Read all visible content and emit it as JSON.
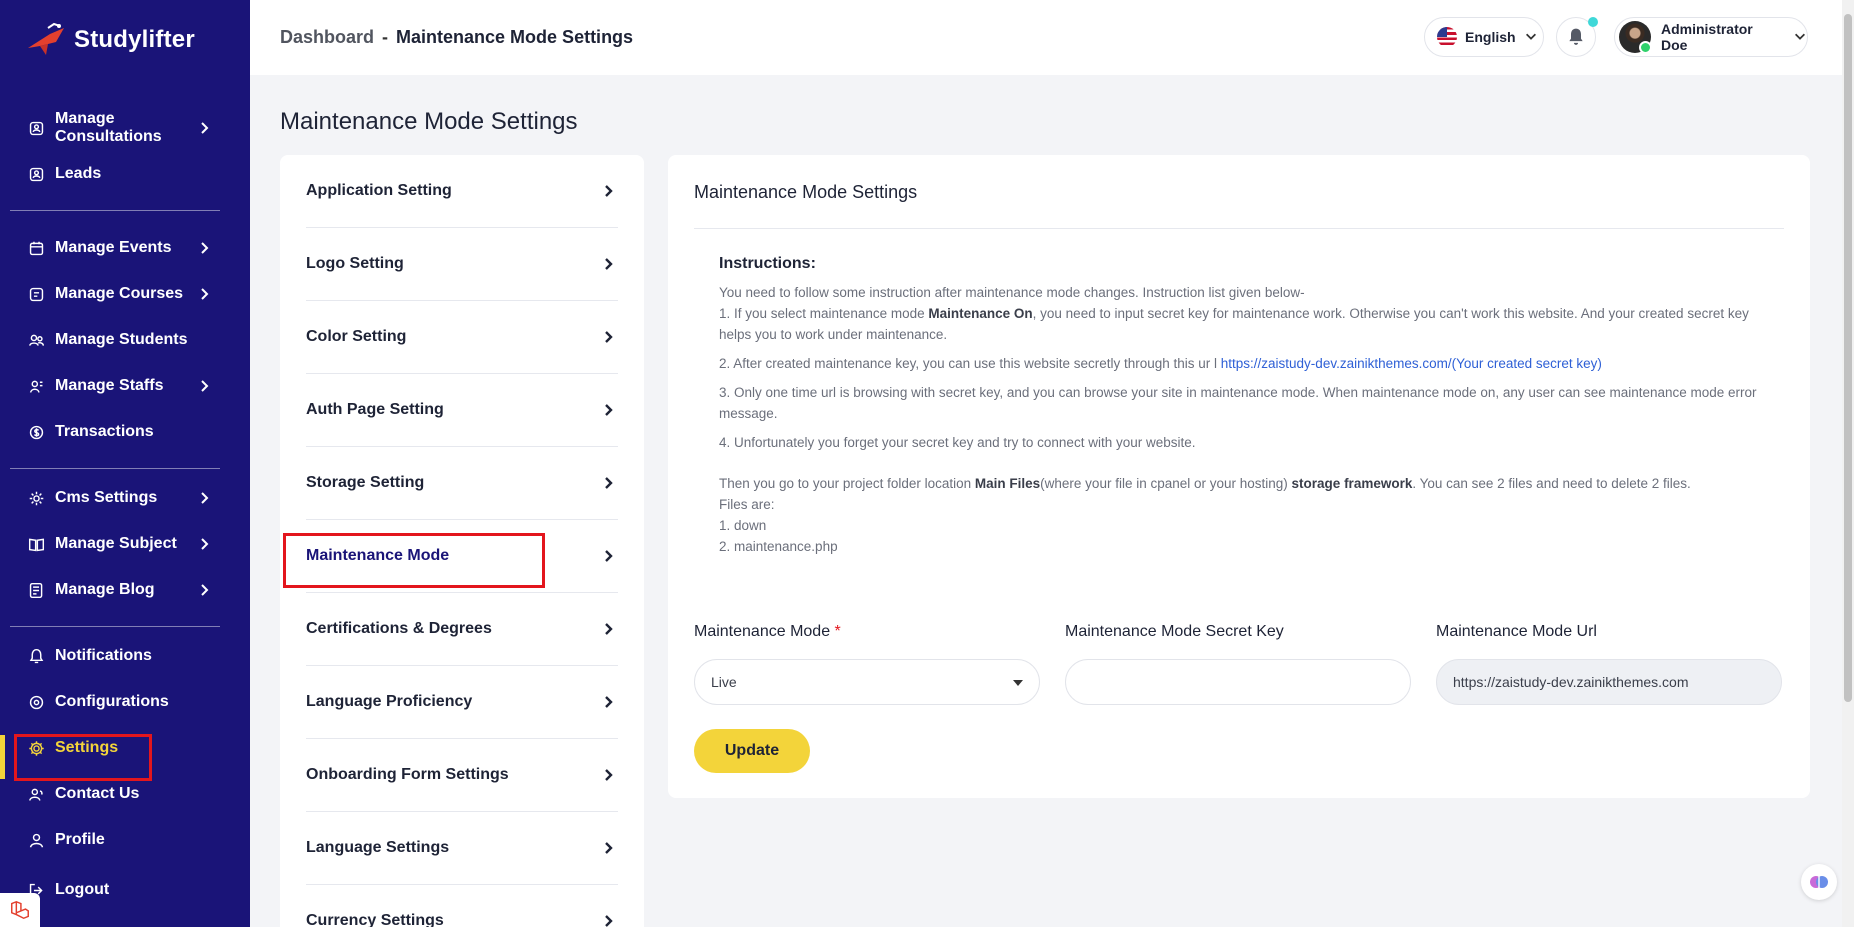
{
  "brand": {
    "name": "Studylifter"
  },
  "sidebar": {
    "groups": [
      [
        {
          "label": "Manage Consultations",
          "icon": "consultations-icon",
          "has_submenu": true
        },
        {
          "label": "Leads",
          "icon": "leads-icon",
          "has_submenu": false
        }
      ],
      [
        {
          "label": "Manage Events",
          "icon": "calendar-icon",
          "has_submenu": true
        },
        {
          "label": "Manage Courses",
          "icon": "courses-icon",
          "has_submenu": true
        },
        {
          "label": "Manage Students",
          "icon": "students-icon",
          "has_submenu": false
        },
        {
          "label": "Manage Staffs",
          "icon": "staffs-icon",
          "has_submenu": true
        },
        {
          "label": "Transactions",
          "icon": "transactions-icon",
          "has_submenu": false
        }
      ],
      [
        {
          "label": "Cms Settings",
          "icon": "cms-settings-icon",
          "has_submenu": true
        },
        {
          "label": "Manage Subject",
          "icon": "book-icon",
          "has_submenu": true
        },
        {
          "label": "Manage Blog",
          "icon": "blog-icon",
          "has_submenu": true
        }
      ],
      [
        {
          "label": "Notifications",
          "icon": "bell-icon",
          "has_submenu": false
        },
        {
          "label": "Configurations",
          "icon": "configurations-icon",
          "has_submenu": false
        },
        {
          "label": "Settings",
          "icon": "gear-icon",
          "has_submenu": false,
          "active": true
        },
        {
          "label": "Contact Us",
          "icon": "contact-icon",
          "has_submenu": false
        },
        {
          "label": "Profile",
          "icon": "user-icon",
          "has_submenu": false
        },
        {
          "label": "Logout",
          "icon": "logout-icon",
          "has_submenu": false
        }
      ]
    ],
    "active_color": "#f3d43a",
    "bg_color": "#1a1478"
  },
  "header": {
    "breadcrumb": {
      "root": "Dashboard",
      "separator": "-",
      "current": "Maintenance Mode Settings"
    },
    "language": "English",
    "user_name": "Administrator Doe"
  },
  "page": {
    "title": "Maintenance Mode Settings"
  },
  "settings_menu": {
    "items": [
      {
        "label": "Application Setting"
      },
      {
        "label": "Logo Setting"
      },
      {
        "label": "Color Setting"
      },
      {
        "label": "Auth Page Setting"
      },
      {
        "label": "Storage Setting"
      },
      {
        "label": "Maintenance Mode",
        "active": true
      },
      {
        "label": "Certifications & Degrees"
      },
      {
        "label": "Language Proficiency"
      },
      {
        "label": "Onboarding Form Settings"
      },
      {
        "label": "Language Settings"
      },
      {
        "label": "Currency Settings"
      }
    ]
  },
  "card": {
    "title": "Maintenance Mode Settings",
    "instructions_title": "Instructions:",
    "intro": "You need to follow some instruction after maintenance mode changes. Instruction list given below-",
    "step1_a": "1. If you select maintenance mode ",
    "step1_b": "Maintenance On",
    "step1_c": ", you need to input secret key for maintenance work. Otherwise you can't work this website. And your created secret key helps you to work under maintenance.",
    "step2_a": "2. After created maintenance key, you can use this website secretly through this ur l ",
    "step2_link": "https://zaistudy-dev.zainikthemes.com/(Your created secret key)",
    "step3": "3. Only one time url is browsing with secret key, and you can browse your site in maintenance mode. When maintenance mode on, any user can see maintenance mode error message.",
    "step4": "4. Unfortunately you forget your secret key and try to connect with your website.",
    "then_a": "Then you go to your project folder location ",
    "then_b": "Main Files",
    "then_c": "(where your file in cpanel or your hosting) ",
    "then_d": "storage framework",
    "then_e": ". You can see 2 files and need to delete 2 files.",
    "files_are": "Files are:",
    "file1": "1. down",
    "file2": "2. maintenance.php",
    "form": {
      "mode_label": "Maintenance Mode",
      "mode_required": "*",
      "mode_value": "Live",
      "secret_label": "Maintenance Mode Secret Key",
      "secret_value": "",
      "url_label": "Maintenance Mode Url",
      "url_value": "https://zaistudy-dev.zainikthemes.com",
      "submit_label": "Update"
    }
  }
}
